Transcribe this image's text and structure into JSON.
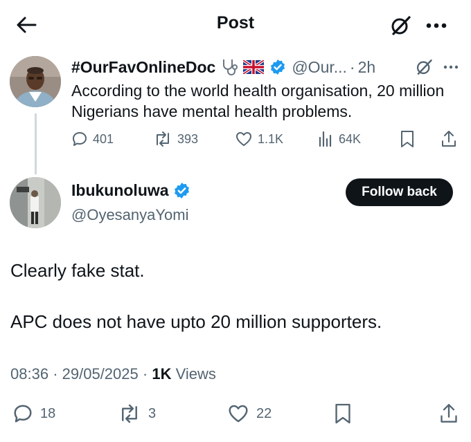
{
  "header": {
    "title": "Post"
  },
  "colors": {
    "verified": "#1d9bf0",
    "text": "#0f1419",
    "muted": "#536471",
    "thread_line": "#cfd9de"
  },
  "parent_post": {
    "name": "#OurFavOnlineDoc",
    "emojis": [
      "stethoscope-icon",
      "uk-flag-icon"
    ],
    "handle": "@Our...",
    "separator": "·",
    "time": "2h",
    "text": "According to the world health organisation, 20 million Nigerians have mental health problems.",
    "stats": {
      "replies": "401",
      "reposts": "393",
      "likes": "1.1K",
      "views": "64K"
    }
  },
  "reply_post": {
    "name": "Ibukunoluwa",
    "handle": "@OyesanyaYomi",
    "follow_label": "Follow back",
    "text_line1": "Clearly fake stat.",
    "text_line2": "APC does not have upto 20 million supporters.",
    "time": "08:36",
    "date": "29/05/2025",
    "views_count": "1K",
    "views_label": "Views",
    "separator": "·",
    "stats": {
      "replies": "18",
      "reposts": "3",
      "likes": "22"
    }
  }
}
